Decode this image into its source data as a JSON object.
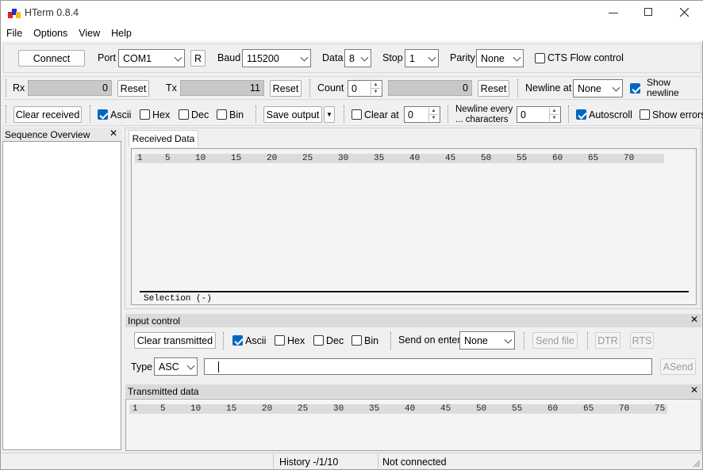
{
  "window": {
    "title": "HTerm 0.8.4"
  },
  "menu": [
    "File",
    "Options",
    "View",
    "Help"
  ],
  "connection": {
    "connect_label": "Connect",
    "port_label": "Port",
    "port_value": "COM1",
    "refresh_label": "R",
    "baud_label": "Baud",
    "baud_value": "115200",
    "data_label": "Data",
    "data_value": "8",
    "stop_label": "Stop",
    "stop_value": "1",
    "parity_label": "Parity",
    "parity_value": "None",
    "cts_label": "CTS Flow control"
  },
  "counters": {
    "rx_label": "Rx",
    "rx_value": "0",
    "reset_label": "Reset",
    "tx_label": "Tx",
    "tx_value": "11",
    "count_label": "Count",
    "count_value": "0",
    "count_total": "0",
    "newline_at_label": "Newline at",
    "newline_at_value": "None",
    "show_newline_label": "Show newline"
  },
  "receive_options": {
    "clear_received_label": "Clear received",
    "ascii_label": "Ascii",
    "hex_label": "Hex",
    "dec_label": "Dec",
    "bin_label": "Bin",
    "save_output_label": "Save output",
    "clear_at_label": "Clear at",
    "clear_at_value": "0",
    "newline_every_label_1": "Newline every",
    "newline_every_label_2": "... characters",
    "newline_every_value": "0",
    "autoscroll_label": "Autoscroll",
    "show_errors_label": "Show errors"
  },
  "sequence_overview": {
    "title": "Sequence Overview",
    "close": "✕"
  },
  "received": {
    "tab_label": "Received Data",
    "ruler": [
      "1",
      "5",
      "10",
      "15",
      "20",
      "25",
      "30",
      "35",
      "40",
      "45",
      "50",
      "55",
      "60",
      "65",
      "70"
    ],
    "selection": "Selection (-)"
  },
  "input_control": {
    "title": "Input control",
    "close": "✕",
    "clear_transmitted_label": "Clear transmitted",
    "ascii_label": "Ascii",
    "hex_label": "Hex",
    "dec_label": "Dec",
    "bin_label": "Bin",
    "send_on_enter_label": "Send on enter",
    "send_on_enter_value": "None",
    "send_file_label": "Send file",
    "dtr_label": "DTR",
    "rts_label": "RTS",
    "type_label": "Type",
    "type_value": "ASC",
    "input_value": "",
    "asend_label": "ASend"
  },
  "transmitted": {
    "title": "Transmitted data",
    "close": "✕",
    "ruler": [
      "1",
      "5",
      "10",
      "15",
      "20",
      "25",
      "30",
      "35",
      "40",
      "45",
      "50",
      "55",
      "60",
      "65",
      "70",
      "75"
    ]
  },
  "status": {
    "history": "History -/1/10",
    "connection": "Not connected"
  },
  "colors": {
    "accent": "#0067c0",
    "readout_bg": "#c8c8c8",
    "panel_head": "#dadada"
  }
}
